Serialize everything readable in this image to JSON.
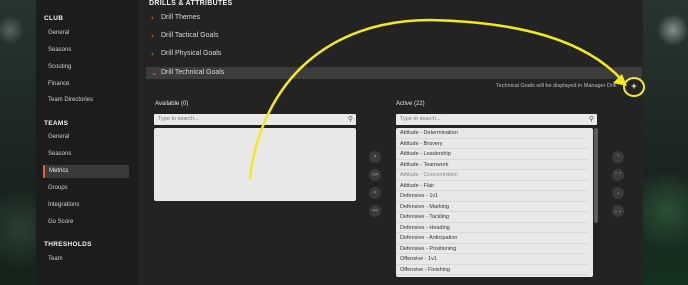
{
  "sidebar": {
    "sections": [
      {
        "title": "CLUB"
      },
      {
        "title": "TEAMS"
      },
      {
        "title": "THRESHOLDS"
      }
    ],
    "club_items": [
      "General",
      "Seasons",
      "Scouting",
      "Finance",
      "Team Directories"
    ],
    "team_items": [
      "General",
      "Seasons",
      "Metrics",
      "Groups",
      "Integrations",
      "Go Score"
    ],
    "threshold_items": [
      "Team"
    ],
    "active_item": "Metrics"
  },
  "main": {
    "title": "DRILLS & ATTRIBUTES",
    "accordion": [
      {
        "label": "Drill Themes"
      },
      {
        "label": "Drill Tactical Goals"
      },
      {
        "label": "Drill Physical Goals"
      },
      {
        "label": "Drill Technical Goals"
      }
    ],
    "info_text": "Technical Goals will be displayed in Manager Drill",
    "add_button": "+",
    "available": {
      "label": "Available (0)",
      "search_placeholder": "Type to search..."
    },
    "active": {
      "label": "Active (22)",
      "search_placeholder": "Type to search...",
      "items": [
        "Attitude - Determination",
        "Attitude - Bravery",
        "Attitude - Leadership",
        "Attitude - Teamwork",
        "Attitude - Concentration",
        "Attitude - Flair",
        "Defensive - 1v1",
        "Defensive - Marking",
        "Defensive - Tackling",
        "Defensive - Heading",
        "Defensive - Anticipation",
        "Defensive - Positioning",
        "Offensive - 1v1",
        "Offensive - Finishing"
      ]
    },
    "transfer_controls": [
      ">",
      ">>",
      "<",
      "<<"
    ],
    "order_controls": [
      "⌃",
      "⌃⌃",
      "⌄",
      "⌄⌄"
    ]
  },
  "colors": {
    "accent": "#e0643a",
    "highlight": "#f2ea1d",
    "sidebar_bg": "#1c1c1c",
    "main_bg": "#232323"
  },
  "icons": {
    "chevron": "chevron-right-icon",
    "search": "search-icon"
  }
}
